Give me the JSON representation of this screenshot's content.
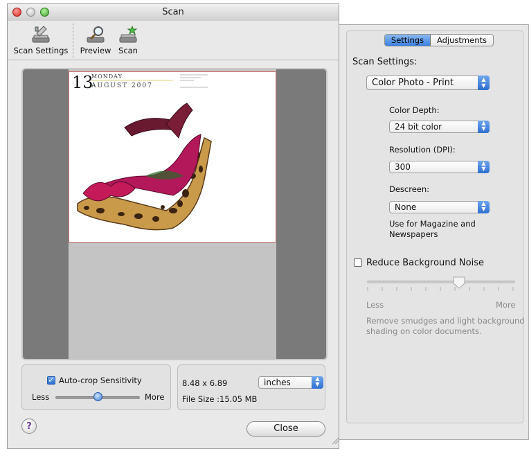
{
  "window": {
    "title": "Scan"
  },
  "toolbar": {
    "scan_settings_label": "Scan Settings",
    "preview_label": "Preview",
    "scan_label": "Scan"
  },
  "preview": {
    "calendar_day": "13",
    "calendar_weekday": "MONDAY",
    "calendar_month": "AUGUST 2007"
  },
  "autocrop": {
    "checkbox_label": "Auto-crop Sensitivity",
    "checked": true,
    "less_label": "Less",
    "more_label": "More",
    "level": 0.5
  },
  "size": {
    "dimensions": "8.48 x 6.89",
    "units": "inches",
    "file_size": "File Size :15.05 MB"
  },
  "buttons": {
    "help": "?",
    "close": "Close"
  },
  "drawer": {
    "tabs": [
      "Settings",
      "Adjustments"
    ],
    "active_tab": "Settings",
    "scan_settings_heading": "Scan Settings:",
    "mode_value": "Color Photo - Print",
    "color_depth_label": "Color Depth:",
    "color_depth_value": "24 bit color",
    "resolution_label": "Resolution (DPI):",
    "resolution_value": "300",
    "descreen_label": "Descreen:",
    "descreen_value": "None",
    "descreen_hint_line1": "Use for Magazine and",
    "descreen_hint_line2": "Newspapers",
    "noise_checkbox_label": "Reduce Background Noise",
    "noise_checked": false,
    "noise_less": "Less",
    "noise_more": "More",
    "noise_level": 0.62,
    "noise_hint_line1": "Remove smudges and light background",
    "noise_hint_line2": "shading on color documents."
  },
  "colors": {
    "accent_blue": "#3a7fe0",
    "preview_bg": "#7a7a7a"
  }
}
